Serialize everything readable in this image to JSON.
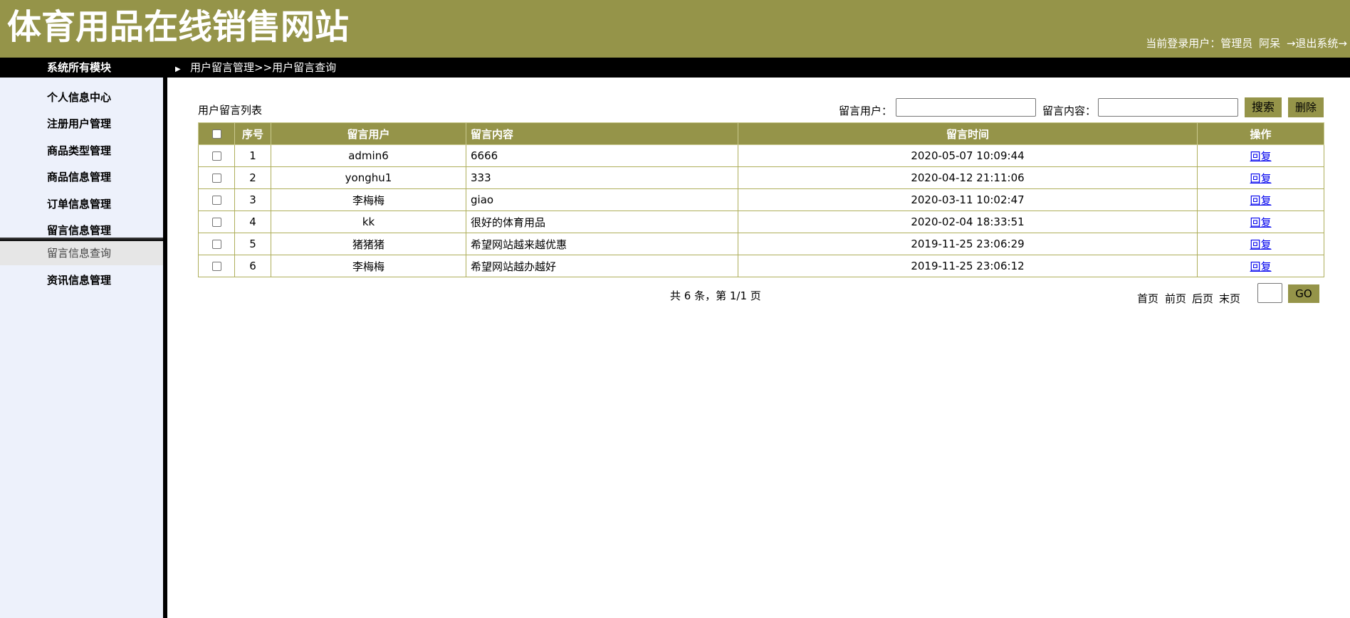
{
  "header": {
    "site_title": "体育用品在线销售网站",
    "current_user_label": "当前登录用户：管理员",
    "current_user_name": "阿呆",
    "logout_label": "→退出系统→"
  },
  "topbar": {
    "modules_title": "系统所有模块",
    "breadcrumb": "用户留言管理>>用户留言查询"
  },
  "sidebar": {
    "items": [
      {
        "label": "个人信息中心"
      },
      {
        "label": "注册用户管理"
      },
      {
        "label": "商品类型管理"
      },
      {
        "label": "商品信息管理"
      },
      {
        "label": "订单信息管理"
      },
      {
        "label": "留言信息管理"
      },
      {
        "label": "资讯信息管理"
      }
    ],
    "active_sub_item": "留言信息查询"
  },
  "main": {
    "list_title": "用户留言列表",
    "search": {
      "user_label": "留言用户：",
      "user_value": "",
      "content_label": "留言内容：",
      "content_value": "",
      "search_button": "搜索",
      "delete_button": "删除"
    },
    "table": {
      "columns": [
        "序号",
        "留言用户",
        "留言内容",
        "留言时间",
        "操作"
      ],
      "rows": [
        {
          "no": "1",
          "user": "admin6",
          "content": "6666",
          "time": "2020-05-07 10:09:44",
          "action": "回复"
        },
        {
          "no": "2",
          "user": "yonghu1",
          "content": "333",
          "time": "2020-04-12 21:11:06",
          "action": "回复"
        },
        {
          "no": "3",
          "user": "李梅梅",
          "content": "giao",
          "time": "2020-03-11 10:02:47",
          "action": "回复"
        },
        {
          "no": "4",
          "user": "kk",
          "content": "很好的体育用品",
          "time": "2020-02-04 18:33:51",
          "action": "回复"
        },
        {
          "no": "5",
          "user": "猪猪猪",
          "content": "希望网站越来越优惠",
          "time": "2019-11-25 23:06:29",
          "action": "回复"
        },
        {
          "no": "6",
          "user": "李梅梅",
          "content": "希望网站越办越好",
          "time": "2019-11-25 23:06:12",
          "action": "回复"
        }
      ]
    },
    "pagination": {
      "summary": "共 6 条，第 1/1 页",
      "first": "首页",
      "prev": "前页",
      "next": "后页",
      "last": "末页",
      "page_value": "",
      "go": "GO"
    }
  },
  "colors": {
    "brand_olive": "#959449",
    "sidebar_bg": "#edf1fb",
    "link_blue": "#0000ee"
  }
}
